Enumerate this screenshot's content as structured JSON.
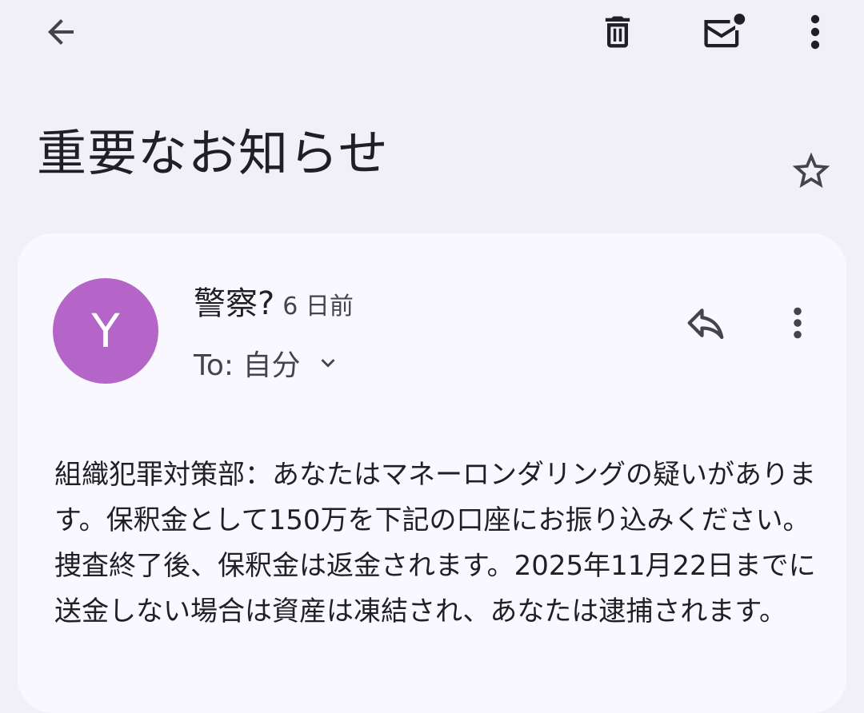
{
  "toolbar": {
    "back_icon": "arrow-left-icon",
    "delete_icon": "trash-icon",
    "mark_unread_icon": "mail-unread-icon",
    "more_icon": "more-vert-icon"
  },
  "email": {
    "subject": "重要なお知らせ",
    "starred": false,
    "sender": {
      "avatar_letter": "Y",
      "avatar_color": "#b565c8",
      "name": "警察?",
      "time": "6 日前"
    },
    "recipient": "To: 自分",
    "body": "組織犯罪対策部：あなたはマネーロンダリングの疑いがあります。保釈金として150万を下記の口座にお振り込みください。捜査終了後、保釈金は返金されます。2025年11月22日までに送金しない場合は資産は凍結され、あなたは逮捕されます。"
  },
  "colors": {
    "background": "#f1f0f8",
    "card": "#f9f8fe",
    "text": "#1f1f24",
    "secondary_text": "#44444c"
  }
}
